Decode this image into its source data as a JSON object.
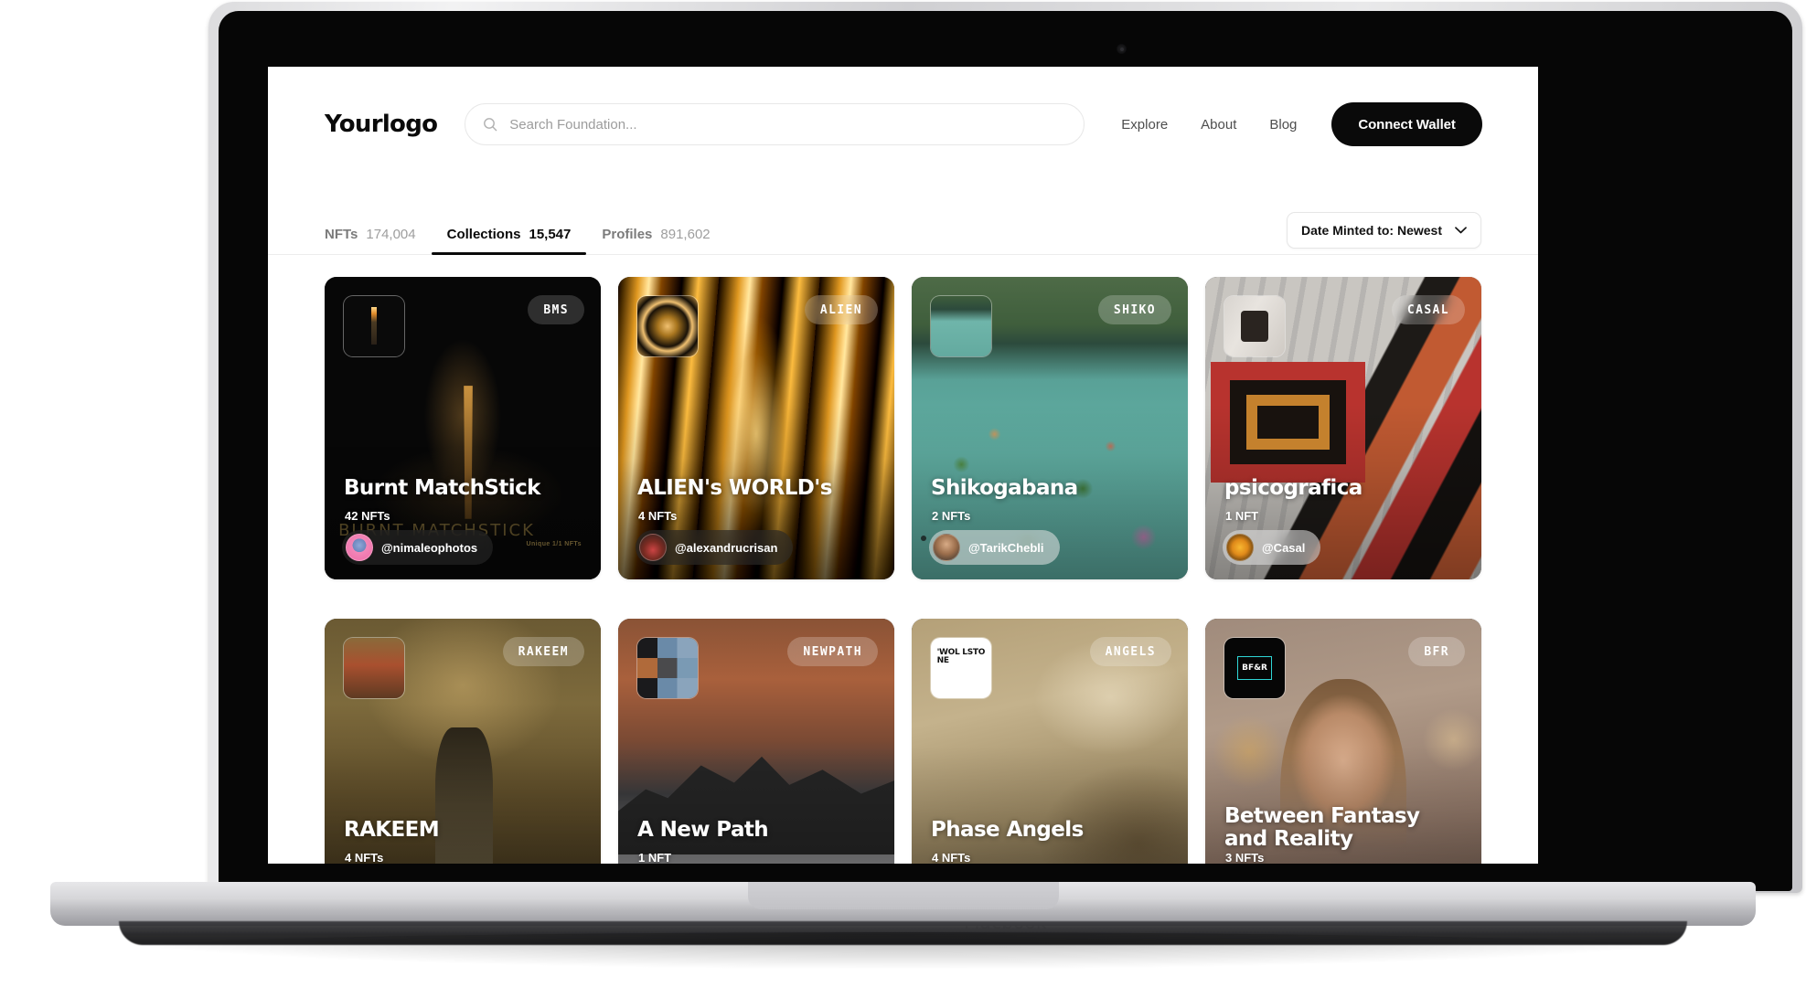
{
  "device": {
    "brand_label": "Macbook"
  },
  "header": {
    "logo": "Yourlogo",
    "search": {
      "placeholder": "Search Foundation...",
      "value": "",
      "icon": "search-icon"
    },
    "nav": [
      {
        "label": "Explore"
      },
      {
        "label": "About"
      },
      {
        "label": "Blog"
      }
    ],
    "wallet_button": "Connect Wallet"
  },
  "tabs": [
    {
      "label": "NFTs",
      "count": "174,004",
      "active": false
    },
    {
      "label": "Collections",
      "count": "15,547",
      "active": true
    },
    {
      "label": "Profiles",
      "count": "891,602",
      "active": false
    }
  ],
  "sort": {
    "label": "Date Minted to: Newest",
    "icon": "chevron-down-icon",
    "options": [
      "Date Minted to: Newest"
    ]
  },
  "collections": [
    {
      "title": "Burnt MatchStick",
      "count": "42 NFTs",
      "badge": "BMS",
      "creator": "@nimaleophotos",
      "art_overlay_title": "BURNT MATCHSTICK",
      "art_overlay_subtitle": "Unique 1/1 NFTs"
    },
    {
      "title": "ALIEN's WORLD's",
      "count": "4 NFTs",
      "badge": "ALIEN",
      "creator": "@alexandrucrisan"
    },
    {
      "title": "Shikogabana",
      "count": "2 NFTs",
      "badge": "SHIKO",
      "creator": "@TarikChebli"
    },
    {
      "title": "psicografica",
      "count": "1 NFT",
      "badge": "CASAL",
      "creator": "@Casal"
    },
    {
      "title": "RAKEEM",
      "count": "4 NFTs",
      "badge": "RAKEEM",
      "creator": ""
    },
    {
      "title": "A New Path",
      "count": "1 NFT",
      "badge": "NEWPATH",
      "creator": ""
    },
    {
      "title": "Phase Angels",
      "count": "4 NFTs",
      "badge": "ANGELS",
      "creator": "",
      "thumb_text": "'WOL LSTO NE"
    },
    {
      "title": "Between Fantasy and Reality",
      "count": "3 NFTs",
      "badge": "BFR",
      "creator": "",
      "thumb_text": "BF&R"
    }
  ],
  "colors": {
    "accent_black": "#0a0a0a",
    "page_bg": "#ffffff",
    "muted_text": "#9e9e9e",
    "border": "#ededed"
  }
}
